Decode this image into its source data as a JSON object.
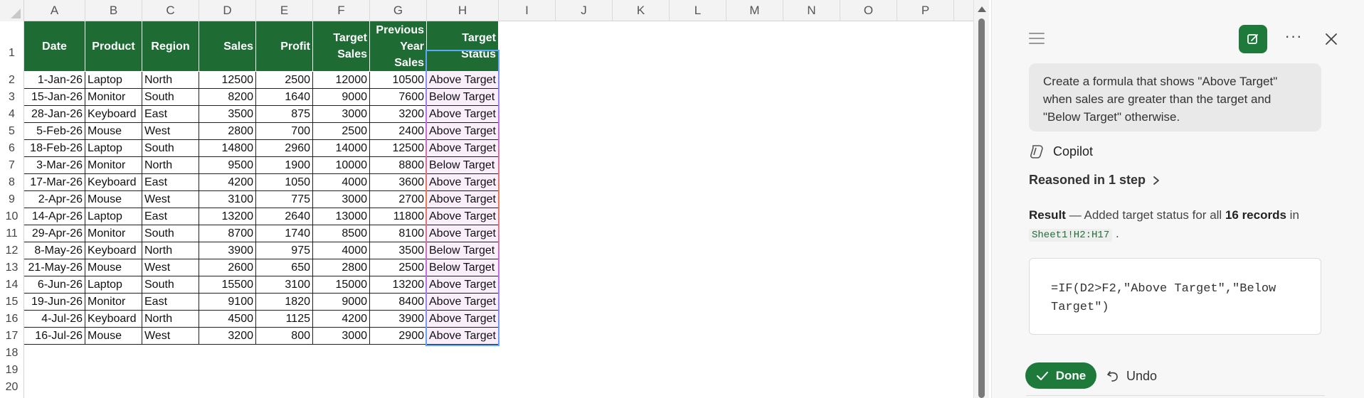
{
  "sheet": {
    "columns": [
      "A",
      "B",
      "C",
      "D",
      "E",
      "F",
      "G",
      "H",
      "I",
      "J",
      "K",
      "L",
      "M",
      "N",
      "O",
      "P"
    ],
    "rows": [
      "1",
      "2",
      "3",
      "4",
      "5",
      "6",
      "7",
      "8",
      "9",
      "10",
      "11",
      "12",
      "13",
      "14",
      "15",
      "16",
      "17",
      "18",
      "19",
      "20"
    ],
    "headers": {
      "date": "Date",
      "product": "Product",
      "region": "Region",
      "sales": "Sales",
      "profit": "Profit",
      "target_sales": "Target Sales",
      "prev_year_sales": "Previous Year Sales",
      "target_status": "Target Status"
    },
    "records": [
      [
        "1-Jan-26",
        "Laptop",
        "North",
        "12500",
        "2500",
        "12000",
        "10500",
        "Above Target"
      ],
      [
        "15-Jan-26",
        "Monitor",
        "South",
        "8200",
        "1640",
        "9000",
        "7600",
        "Below Target"
      ],
      [
        "28-Jan-26",
        "Keyboard",
        "East",
        "3500",
        "875",
        "3000",
        "3200",
        "Above Target"
      ],
      [
        "5-Feb-26",
        "Mouse",
        "West",
        "2800",
        "700",
        "2500",
        "2400",
        "Above Target"
      ],
      [
        "18-Feb-26",
        "Laptop",
        "South",
        "14800",
        "2960",
        "14000",
        "12500",
        "Above Target"
      ],
      [
        "3-Mar-26",
        "Monitor",
        "North",
        "9500",
        "1900",
        "10000",
        "8800",
        "Below Target"
      ],
      [
        "17-Mar-26",
        "Keyboard",
        "East",
        "4200",
        "1050",
        "4000",
        "3600",
        "Above Target"
      ],
      [
        "2-Apr-26",
        "Mouse",
        "West",
        "3100",
        "775",
        "3000",
        "2700",
        "Above Target"
      ],
      [
        "14-Apr-26",
        "Laptop",
        "East",
        "13200",
        "2640",
        "13000",
        "11800",
        "Above Target"
      ],
      [
        "29-Apr-26",
        "Monitor",
        "South",
        "8700",
        "1740",
        "8500",
        "8100",
        "Above Target"
      ],
      [
        "8-May-26",
        "Keyboard",
        "North",
        "3900",
        "975",
        "4000",
        "3500",
        "Below Target"
      ],
      [
        "21-May-26",
        "Mouse",
        "West",
        "2600",
        "650",
        "2800",
        "2500",
        "Below Target"
      ],
      [
        "6-Jun-26",
        "Laptop",
        "South",
        "15500",
        "3100",
        "15000",
        "13200",
        "Above Target"
      ],
      [
        "19-Jun-26",
        "Monitor",
        "East",
        "9100",
        "1820",
        "9000",
        "8400",
        "Above Target"
      ],
      [
        "4-Jul-26",
        "Keyboard",
        "North",
        "4500",
        "1125",
        "4200",
        "3900",
        "Above Target"
      ],
      [
        "16-Jul-26",
        "Mouse",
        "West",
        "3200",
        "800",
        "3000",
        "2900",
        "Above Target"
      ]
    ]
  },
  "pane": {
    "prompt": "Create a formula that shows \"Above Target\" when sales are greater than the target and \"Below Target\" otherwise.",
    "assistant_name": "Copilot",
    "reasoned": "Reasoned in 1 step",
    "result_label": "Result",
    "result_mid": " — Added target status for all ",
    "result_count": "16 records",
    "result_in": " in",
    "result_range": "Sheet1!H2:H17",
    "result_end": " .",
    "formula": "=IF(D2>F2,\"Above Target\",\"Below Target\")",
    "done_label": "Done",
    "undo_label": "Undo",
    "more_label": "···"
  },
  "colors": {
    "header_green": "#1e6b34",
    "accent_green": "#1e7a3a",
    "status_fill": "#fbeefb"
  }
}
